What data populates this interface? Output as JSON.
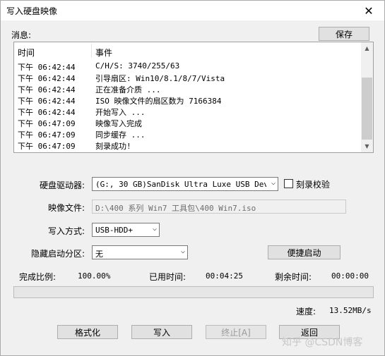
{
  "window": {
    "title": "写入硬盘映像",
    "close_label": "✕"
  },
  "messages": {
    "label": "消息:",
    "save_label": "保存",
    "columns": [
      "时间",
      "事件"
    ],
    "rows": [
      {
        "time": "下午 06:42:44",
        "event": "C/H/S: 3740/255/63"
      },
      {
        "time": "下午 06:42:44",
        "event": "引导扇区: Win10/8.1/8/7/Vista"
      },
      {
        "time": "下午 06:42:44",
        "event": "正在准备介质 ..."
      },
      {
        "time": "下午 06:42:44",
        "event": "ISO 映像文件的扇区数为 7166384"
      },
      {
        "time": "下午 06:42:44",
        "event": "开始写入 ..."
      },
      {
        "time": "下午 06:47:09",
        "event": "映像写入完成"
      },
      {
        "time": "下午 06:47:09",
        "event": "同步缓存 ..."
      },
      {
        "time": "下午 06:47:09",
        "event": "刻录成功!"
      }
    ]
  },
  "form": {
    "drive_label": "硬盘驱动器:",
    "drive_value": "(G:, 30 GB)SanDisk Ultra Luxe USB Devic",
    "verify_label": "刻录校验",
    "verify_checked": false,
    "image_label": "映像文件:",
    "image_value": "D:\\400 系列 Win7 工具包\\400 Win7.iso",
    "write_mode_label": "写入方式:",
    "write_mode_value": "USB-HDD+",
    "hidden_partition_label": "隐藏启动分区:",
    "hidden_partition_value": "无",
    "quick_boot_label": "便捷启动"
  },
  "status": {
    "completion_label": "完成比例:",
    "completion_value": "100.00%",
    "elapsed_label": "已用时间:",
    "elapsed_value": "00:04:25",
    "remaining_label": "剩余时间:",
    "remaining_value": "00:00:00",
    "speed_label": "速度:",
    "speed_value": "13.52MB/s",
    "progress": 0.0
  },
  "buttons": {
    "format_label": "格式化",
    "write_label": "写入",
    "abort_label": "终止[A]",
    "back_label": "返回"
  },
  "watermark": "知乎 @CSDN博客"
}
